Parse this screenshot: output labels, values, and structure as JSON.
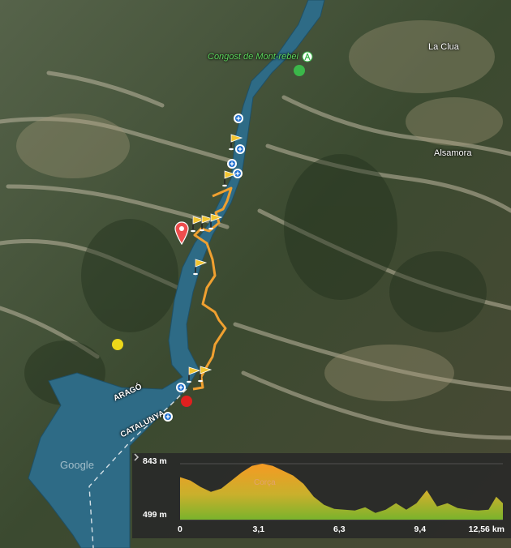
{
  "map": {
    "places": {
      "la_clua": "La Clua",
      "alsamora": "Alsamora",
      "congost": "Congost de Mont-rebei",
      "arago": "ARAGÓ",
      "catalunya": "CATALUNYA",
      "watermark": "Google"
    },
    "colors": {
      "route": "#f0a030",
      "water": "#2e6b86",
      "start": "#e0201f",
      "end": "#3bb74a",
      "poi": "#ecd81a"
    }
  },
  "elevation_profile": {
    "y_max": "843 m",
    "y_min": "499 m",
    "x_ticks": [
      "0",
      "3,1",
      "6,3",
      "9,4",
      "12,56 km"
    ],
    "peak_label": "Corça",
    "chart_data": {
      "type": "area",
      "ylim": [
        499,
        843
      ],
      "xlim": [
        0,
        12.56
      ],
      "x": [
        0,
        0.4,
        0.8,
        1.2,
        1.6,
        2.0,
        2.4,
        2.8,
        3.2,
        3.6,
        4.0,
        4.4,
        4.8,
        5.2,
        5.6,
        6.0,
        6.4,
        6.8,
        7.2,
        7.6,
        8.0,
        8.4,
        8.8,
        9.2,
        9.6,
        10.0,
        10.4,
        10.8,
        11.2,
        11.6,
        12.0,
        12.3,
        12.56
      ],
      "y": [
        760,
        740,
        700,
        670,
        690,
        740,
        790,
        830,
        843,
        830,
        800,
        770,
        720,
        640,
        590,
        565,
        560,
        555,
        575,
        540,
        560,
        600,
        560,
        600,
        680,
        580,
        600,
        570,
        560,
        555,
        560,
        640,
        600
      ]
    }
  }
}
